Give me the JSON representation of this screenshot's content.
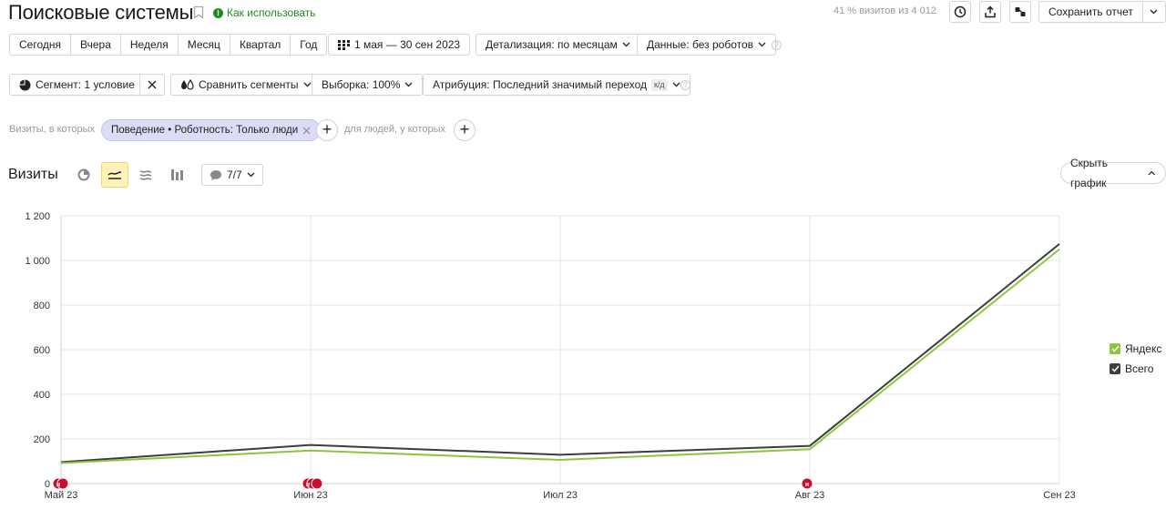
{
  "header": {
    "title": "Поисковые системы",
    "how_to_use": "Как использовать",
    "visits_share": "41 % визитов из 4 012",
    "save_report": "Сохранить отчет"
  },
  "periods": [
    "Сегодня",
    "Вчера",
    "Неделя",
    "Месяц",
    "Квартал",
    "Год"
  ],
  "date_range": "1 мая — 30 сен 2023",
  "detail": "Детализация: по месяцам",
  "data_mode": "Данные: без роботов",
  "segment": "Сегмент: 1 условие",
  "compare": "Сравнить сегменты",
  "sample": "Выборка: 100%",
  "attribution": "Атрибуция: Последний значимый переход",
  "attribution_badge": "к/д",
  "filter": {
    "visits_label": "Визиты, в которых",
    "chip": "Поведение • Роботность: Только люди",
    "people_label": "для людей, у которых"
  },
  "section": {
    "title": "Визиты",
    "notes_count": "7/7",
    "hide_chart": "Скрыть график"
  },
  "colors": {
    "yandex": "#8cc63f",
    "total": "#3d3d3d",
    "marker": "#c8102e",
    "accent_chip": "#dcdcf6"
  },
  "chart_data": {
    "type": "line",
    "x": [
      "Май 23",
      "Июн 23",
      "Июл 23",
      "Авг 23",
      "Сен 23"
    ],
    "series": [
      {
        "name": "Яндекс",
        "values": [
          92,
          148,
          106,
          154,
          1050
        ]
      },
      {
        "name": "Всего",
        "values": [
          96,
          173,
          129,
          169,
          1074
        ]
      }
    ],
    "y_ticks": [
      "0",
      "200",
      "400",
      "600",
      "800",
      "1 000",
      "1 200"
    ],
    "ylim": [
      0,
      1200
    ],
    "grid": true,
    "legend": "right",
    "marker_label": "н"
  }
}
